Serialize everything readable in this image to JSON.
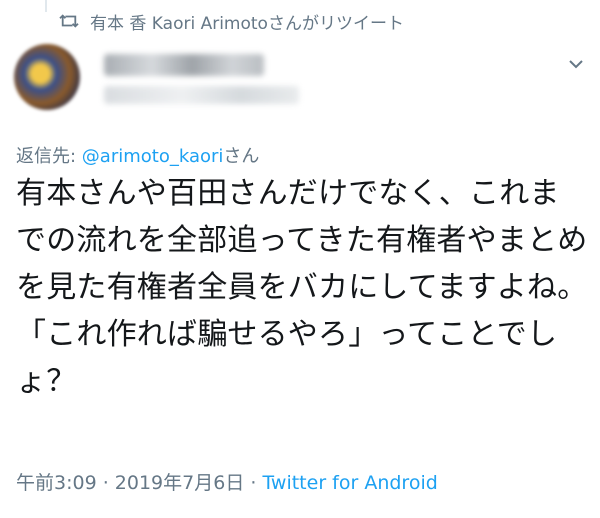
{
  "retweet_notice": {
    "icon": "retweet-icon",
    "text": "有本 香 Kaori Arimotoさんがリツイート"
  },
  "author": {
    "name": "",
    "handle": ""
  },
  "reply_to": {
    "prefix": "返信先: ",
    "mention": "@arimoto_kaori",
    "suffix": "さん"
  },
  "tweet": {
    "text": "有本さんや百田さんだけでなく、これまでの流れを全部追ってきた有権者やまとめを見た有権者全員をバカにしてますよね。\n「これ作れば騙せるやろ」ってことでしょ？"
  },
  "meta": {
    "time": "午前3:09",
    "sep1": " · ",
    "date": "2019年7月6日",
    "sep2": " · ",
    "client": "Twitter for Android"
  },
  "colors": {
    "accent": "#1da1f2",
    "secondary_text": "#657786"
  }
}
